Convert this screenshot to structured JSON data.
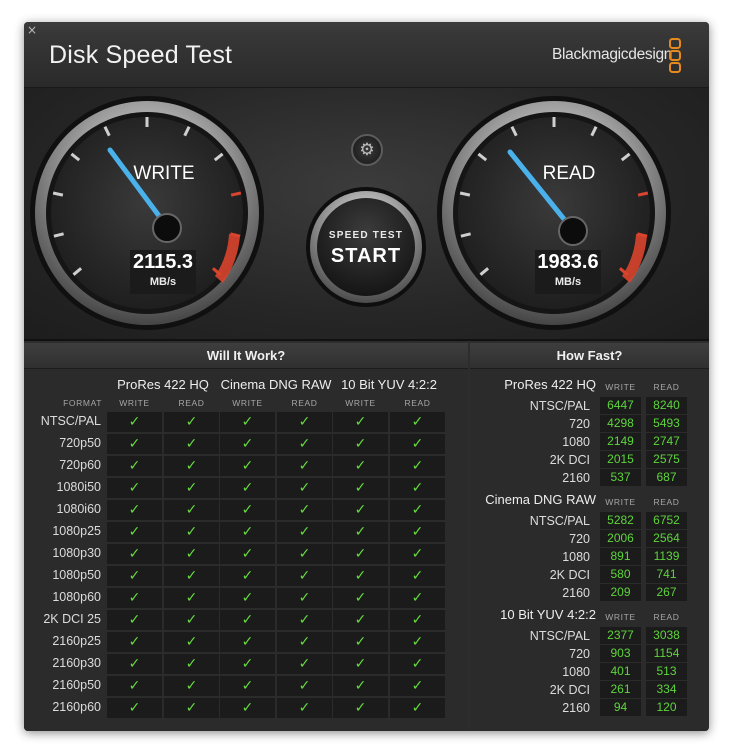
{
  "window": {
    "title": "Disk Speed Test",
    "brand": "Blackmagicdesign",
    "close_glyph": "×"
  },
  "colors": {
    "accent_needle": "#4ab1ea",
    "check_green": "#66dd3e",
    "value_green": "#5ed43c",
    "redline": "#d9442e"
  },
  "icons": {
    "close": "close-icon",
    "settings": "gear-icon",
    "brand": "blackmagic-logo-icon"
  },
  "gauges": {
    "write": {
      "label": "WRITE",
      "value": "2115.3",
      "unit": "MB/s"
    },
    "read": {
      "label": "READ",
      "value": "1983.6",
      "unit": "MB/s"
    }
  },
  "start_button": {
    "caption": "SPEED TEST",
    "label": "START"
  },
  "settings_button": {
    "glyph": "⚙"
  },
  "will_it_work": {
    "title": "Will It Work?",
    "format_label": "FORMAT",
    "write_label": "WRITE",
    "read_label": "READ",
    "check": "✓",
    "groups": [
      "ProRes 422 HQ",
      "Cinema DNG RAW",
      "10 Bit YUV 4:2:2"
    ],
    "formats": [
      "NTSC/PAL",
      "720p50",
      "720p60",
      "1080i50",
      "1080i60",
      "1080p25",
      "1080p30",
      "1080p50",
      "1080p60",
      "2K DCI 25",
      "2160p25",
      "2160p30",
      "2160p50",
      "2160p60"
    ]
  },
  "how_fast": {
    "title": "How Fast?",
    "write_label": "WRITE",
    "read_label": "READ",
    "sections": [
      {
        "name": "ProRes 422 HQ",
        "rows": [
          {
            "format": "NTSC/PAL",
            "write": "6447",
            "read": "8240"
          },
          {
            "format": "720",
            "write": "4298",
            "read": "5493"
          },
          {
            "format": "1080",
            "write": "2149",
            "read": "2747"
          },
          {
            "format": "2K DCI",
            "write": "2015",
            "read": "2575"
          },
          {
            "format": "2160",
            "write": "537",
            "read": "687"
          }
        ]
      },
      {
        "name": "Cinema DNG RAW",
        "rows": [
          {
            "format": "NTSC/PAL",
            "write": "5282",
            "read": "6752"
          },
          {
            "format": "720",
            "write": "2006",
            "read": "2564"
          },
          {
            "format": "1080",
            "write": "891",
            "read": "1139"
          },
          {
            "format": "2K DCI",
            "write": "580",
            "read": "741"
          },
          {
            "format": "2160",
            "write": "209",
            "read": "267"
          }
        ]
      },
      {
        "name": "10 Bit YUV 4:2:2",
        "rows": [
          {
            "format": "NTSC/PAL",
            "write": "2377",
            "read": "3038"
          },
          {
            "format": "720",
            "write": "903",
            "read": "1154"
          },
          {
            "format": "1080",
            "write": "401",
            "read": "513"
          },
          {
            "format": "2K DCI",
            "write": "261",
            "read": "334"
          },
          {
            "format": "2160",
            "write": "94",
            "read": "120"
          }
        ]
      }
    ]
  }
}
